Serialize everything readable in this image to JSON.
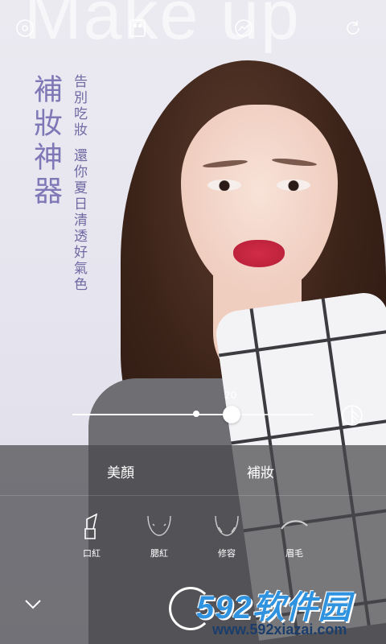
{
  "header": {
    "background_text": "Make up",
    "icons": [
      "disc-icon",
      "grid-icon",
      "image-compare-icon",
      "refresh-icon"
    ]
  },
  "promo": {
    "title": "補妝神器",
    "subtitle_line1": "告別吃妝",
    "subtitle_line2": "還你夏日清透好氣色",
    "accent_color": "#7f78b7"
  },
  "slider": {
    "value_label": "20",
    "value_fraction": 0.66
  },
  "panel": {
    "tabs": [
      {
        "label": "美顏"
      },
      {
        "label": "補妝"
      }
    ],
    "active_tab": "補妝",
    "tools": [
      {
        "label": "口紅",
        "icon": "lipstick-icon"
      },
      {
        "label": "腮紅",
        "icon": "blush-icon"
      },
      {
        "label": "修容",
        "icon": "contour-icon"
      },
      {
        "label": "眉毛",
        "icon": "eyebrow-icon"
      }
    ]
  },
  "watermark": {
    "brand": "592软件园",
    "url": "www.592xiazai.com"
  }
}
